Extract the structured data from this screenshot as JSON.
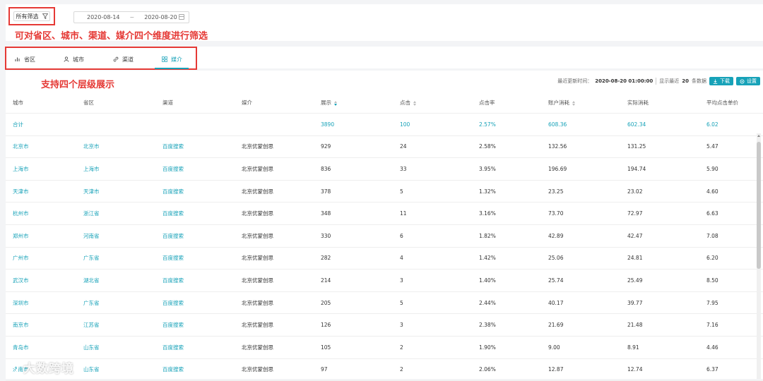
{
  "filter": {
    "label": "所有筛选",
    "date_start": "2020-08-14",
    "date_sep": "~",
    "date_end": "2020-08-20"
  },
  "annotations": {
    "filter_note": "可对省区、城市、渠道、媒介四个维度进行筛选",
    "levels_note": "支持四个层级展示"
  },
  "tabs": [
    {
      "label": "省区",
      "icon": "bar-chart-icon"
    },
    {
      "label": "城市",
      "icon": "user-icon"
    },
    {
      "label": "渠道",
      "icon": "link-icon"
    },
    {
      "label": "媒介",
      "icon": "grid-icon",
      "active": true
    }
  ],
  "toolbar": {
    "updated_label": "最近更新时间：",
    "updated_value": "2020-08-20 01:00:00",
    "showing_prefix": "显示最近",
    "showing_count": "20",
    "showing_suffix": "条数据",
    "download_label": "下载",
    "settings_label": "设置"
  },
  "table": {
    "columns": [
      "城市",
      "省区",
      "渠道",
      "媒介",
      "展示",
      "点击",
      "点击率",
      "账户消耗",
      "实际消耗",
      "平均点击单价"
    ],
    "total": [
      "合计",
      "",
      "",
      "",
      "3890",
      "100",
      "2.57%",
      "608.36",
      "602.34",
      "6.02"
    ],
    "rows": [
      [
        "北京市",
        "北京市",
        "百度搜索",
        "北京优蒙创思",
        "929",
        "24",
        "2.58%",
        "132.56",
        "131.25",
        "5.47"
      ],
      [
        "上海市",
        "上海市",
        "百度搜索",
        "北京优蒙创思",
        "836",
        "33",
        "3.95%",
        "196.69",
        "194.74",
        "5.90"
      ],
      [
        "天津市",
        "天津市",
        "百度搜索",
        "北京优蒙创思",
        "378",
        "5",
        "1.32%",
        "23.25",
        "23.02",
        "4.60"
      ],
      [
        "杭州市",
        "浙江省",
        "百度搜索",
        "北京优蒙创思",
        "348",
        "11",
        "3.16%",
        "73.70",
        "72.97",
        "6.63"
      ],
      [
        "郑州市",
        "河南省",
        "百度搜索",
        "北京优蒙创思",
        "330",
        "6",
        "1.82%",
        "42.89",
        "42.47",
        "7.08"
      ],
      [
        "广州市",
        "广东省",
        "百度搜索",
        "北京优蒙创思",
        "282",
        "4",
        "1.42%",
        "25.06",
        "24.81",
        "6.20"
      ],
      [
        "武汉市",
        "湖北省",
        "百度搜索",
        "北京优蒙创思",
        "214",
        "3",
        "1.40%",
        "25.74",
        "25.49",
        "8.50"
      ],
      [
        "深圳市",
        "广东省",
        "百度搜索",
        "北京优蒙创思",
        "205",
        "5",
        "2.44%",
        "40.17",
        "39.77",
        "7.95"
      ],
      [
        "南京市",
        "江苏省",
        "百度搜索",
        "北京优蒙创思",
        "126",
        "3",
        "2.38%",
        "21.69",
        "21.48",
        "7.16"
      ],
      [
        "青岛市",
        "山东省",
        "百度搜索",
        "北京优蒙创思",
        "105",
        "2",
        "1.90%",
        "9.00",
        "8.91",
        "4.46"
      ],
      [
        "济南市",
        "山东省",
        "百度搜索",
        "北京优蒙创思",
        "97",
        "2",
        "2.06%",
        "12.87",
        "12.74",
        "6.37"
      ]
    ]
  },
  "watermark": "大数跨境",
  "colors": {
    "accent": "#17a2b8",
    "annotation": "#e53935"
  }
}
